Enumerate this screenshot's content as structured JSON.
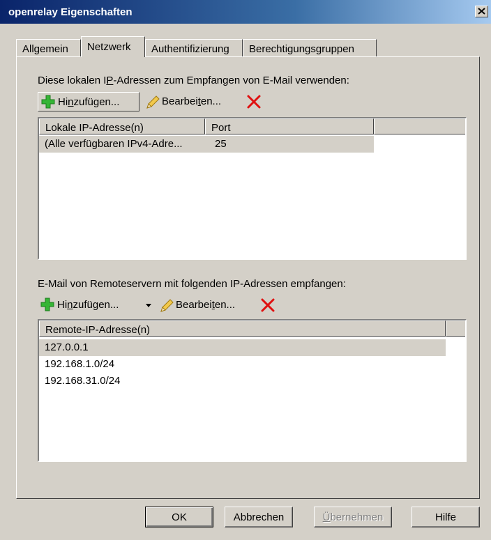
{
  "window": {
    "title": "openrelay Eigenschaften",
    "close_label": "×"
  },
  "tabs": [
    {
      "label": "Allgemein",
      "active": false
    },
    {
      "label": "Netzwerk",
      "active": true
    },
    {
      "label": "Authentifizierung",
      "active": false
    },
    {
      "label": "Berechtigungsgruppen",
      "active": false
    }
  ],
  "local": {
    "label_pre": "Diese lokalen I",
    "label_ul": "P",
    "label_post": "-Adressen zum Empfangen von E-Mail verwenden:",
    "add_pre": "Hi",
    "add_ul": "n",
    "add_post": "zufügen...",
    "edit_pre": "Bearbei",
    "edit_ul": "t",
    "edit_post": "en...",
    "columns": [
      "Lokale IP-Adresse(n)",
      "Port"
    ],
    "rows": [
      {
        "ip": "(Alle verfügbaren IPv4-Adre...",
        "port": "25"
      }
    ]
  },
  "remote": {
    "label": "E-Mail von Remoteservern mit folgenden IP-Adressen empfangen:",
    "add_pre": "Hi",
    "add_ul": "n",
    "add_post": "zufügen...",
    "edit_pre": "Bearbei",
    "edit_ul": "t",
    "edit_post": "en...",
    "columns": [
      "Remote-IP-Adresse(n)"
    ],
    "rows": [
      "127.0.0.1",
      "192.168.1.0/24",
      "192.168.31.0/24"
    ]
  },
  "buttons": {
    "ok": "OK",
    "cancel": "Abbrechen",
    "apply_ul": "Ü",
    "apply_post": "bernehmen",
    "help": "Hilfe"
  },
  "icons": {
    "add": "plus-icon",
    "edit": "pencil-icon",
    "delete": "red-x-icon",
    "dropdown": "chevron-down-icon"
  },
  "colors": {
    "title_bar": "#0a246a",
    "face": "#d4d0c8",
    "add_icon": "#2fa82f",
    "delete_icon": "#e01010"
  }
}
